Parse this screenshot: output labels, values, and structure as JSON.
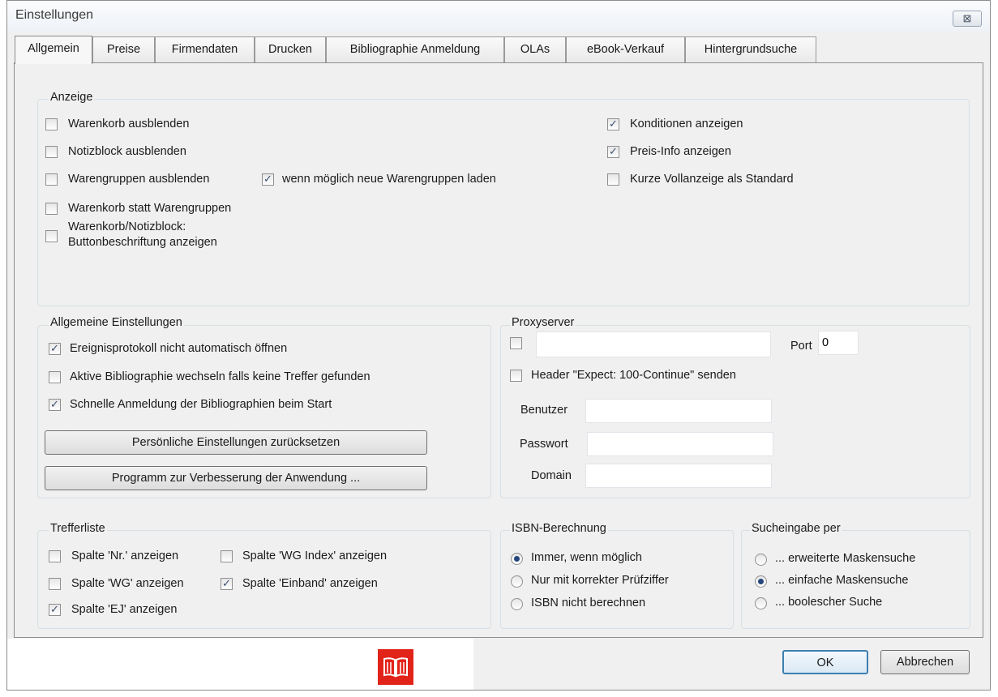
{
  "window": {
    "title": "Einstellungen",
    "close_glyph": "⊠"
  },
  "tabs": [
    "Allgemein",
    "Preise",
    "Firmendaten",
    "Drucken",
    "Bibliographie Anmeldung",
    "OLAs",
    "eBook-Verkauf",
    "Hintergrundsuche"
  ],
  "anzeige": {
    "legend": "Anzeige",
    "warenkorb_ausblenden": "Warenkorb ausblenden",
    "notizblock_ausblenden": "Notizblock ausblenden",
    "warengruppen_ausblenden": "Warengruppen ausblenden",
    "neue_warengruppen": "wenn möglich neue Warengruppen laden",
    "warenkorb_statt": "Warenkorb statt Warengruppen",
    "buttonbeschriftung_1": "Warenkorb/Notizblock:",
    "buttonbeschriftung_2": "Buttonbeschriftung anzeigen",
    "konditionen": "Konditionen anzeigen",
    "preis_info": "Preis-Info anzeigen",
    "kurze_vollanzeige": "Kurze Vollanzeige als Standard"
  },
  "allgemein": {
    "legend": "Allgemeine Einstellungen",
    "ereignisprotokoll": "Ereignisprotokoll nicht automatisch öffnen",
    "aktive_bibliographie": "Aktive Bibliographie wechseln falls keine Treffer gefunden",
    "schnelle_anmeldung": "Schnelle Anmeldung der Bibliographien beim Start",
    "reset_button": "Persönliche Einstellungen zurücksetzen",
    "programm_button": "Programm zur Verbesserung der Anwendung ..."
  },
  "proxy": {
    "legend": "Proxyserver",
    "server_value": "",
    "port_label": "Port",
    "port_value": "0",
    "header_expect": "Header \"Expect: 100-Continue\" senden",
    "benutzer_label": "Benutzer",
    "benutzer_value": "",
    "passwort_label": "Passwort",
    "passwort_value": "",
    "domain_label": "Domain",
    "domain_value": ""
  },
  "trefferliste": {
    "legend": "Trefferliste",
    "spalte_nr": "Spalte 'Nr.' anzeigen",
    "spalte_wg_index": "Spalte 'WG Index' anzeigen",
    "spalte_wg": "Spalte 'WG' anzeigen",
    "spalte_einband": "Spalte 'Einband' anzeigen",
    "spalte_ej": "Spalte 'EJ' anzeigen"
  },
  "isbn": {
    "legend": "ISBN-Berechnung",
    "immer": "Immer, wenn möglich",
    "nur_korrekt": "Nur mit korrekter Prüfziffer",
    "nicht": "ISBN nicht berechnen"
  },
  "sucheingabe": {
    "legend": "Sucheingabe per",
    "erweitert": "... erweiterte Maskensuche",
    "einfach": "... einfache Maskensuche",
    "boolesch": "... boolescher Suche"
  },
  "footer": {
    "ok": "OK",
    "abbrechen": "Abbrechen",
    "logo_icon": "book-icon"
  },
  "colors": {
    "logo_red": "#e2231a",
    "checkmark": "#3d4f73",
    "radio_dot": "#24457a",
    "ok_border": "#3c7fb1"
  }
}
